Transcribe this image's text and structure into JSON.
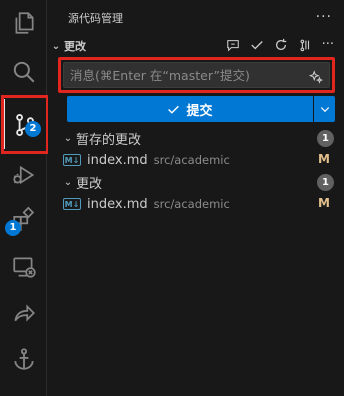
{
  "activity_bar": {
    "scm_badge": "2",
    "extensions_badge": "1"
  },
  "sidebar": {
    "title": "源代码管理",
    "more_label": "···",
    "changes_section": {
      "title": "更改",
      "commit_placeholder": "消息(⌘Enter 在“master”提交)",
      "commit_button_label": "提交"
    },
    "staged": {
      "label": "暂存的更改",
      "count": "1",
      "files": [
        {
          "icon": "M↓",
          "name": "index.md",
          "path": "src/academic",
          "status": "M"
        }
      ]
    },
    "unstaged": {
      "label": "更改",
      "count": "1",
      "files": [
        {
          "icon": "M↓",
          "name": "index.md",
          "path": "src/academic",
          "status": "M"
        }
      ]
    }
  },
  "colors": {
    "accent": "#0078d4",
    "highlight": "#e0261e",
    "modified": "#e2c08d"
  }
}
